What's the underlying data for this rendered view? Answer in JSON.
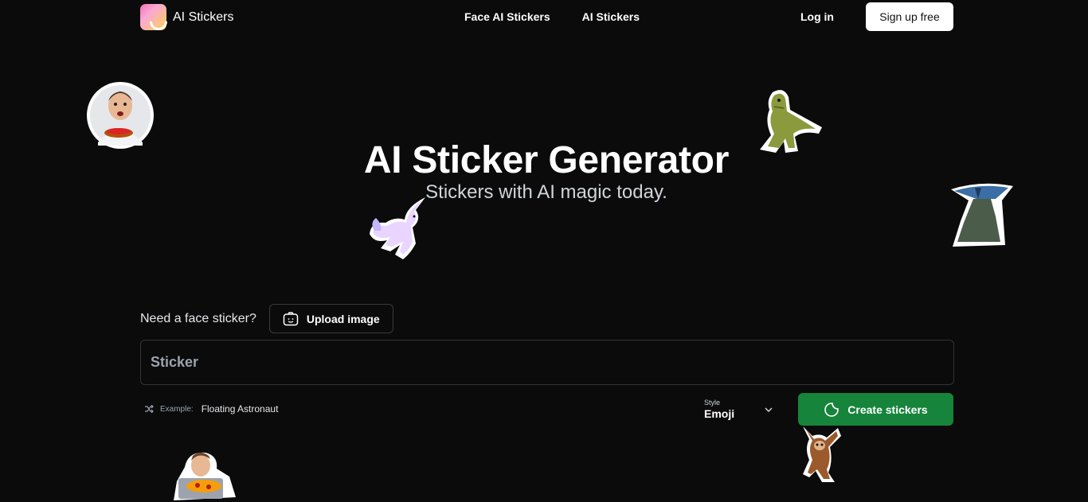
{
  "header": {
    "logo_text": "AI Stickers",
    "nav": [
      "Face AI Stickers",
      "AI Stickers"
    ],
    "login": "Log in",
    "signup": "Sign up free"
  },
  "hero": {
    "title": "AI Sticker Generator",
    "subtitle": "Stickers with AI magic today."
  },
  "face_prompt": {
    "label": "Need a face sticker?",
    "upload_button": "Upload image"
  },
  "prompt_input": {
    "placeholder": "Sticker",
    "value": ""
  },
  "example": {
    "label": "Example:",
    "text": "Floating Astronaut"
  },
  "style": {
    "caption": "Style",
    "value": "Emoji"
  },
  "create_button": "Create stickers",
  "colors": {
    "background": "#0b0b0b",
    "accent_green": "#16843b"
  },
  "decorative_stickers": [
    "man-eating-pizza-sticker",
    "dinosaur-sticker",
    "unicorn-sticker",
    "castle-sticker",
    "pizza-laptop-sticker",
    "sloth-sticker"
  ]
}
